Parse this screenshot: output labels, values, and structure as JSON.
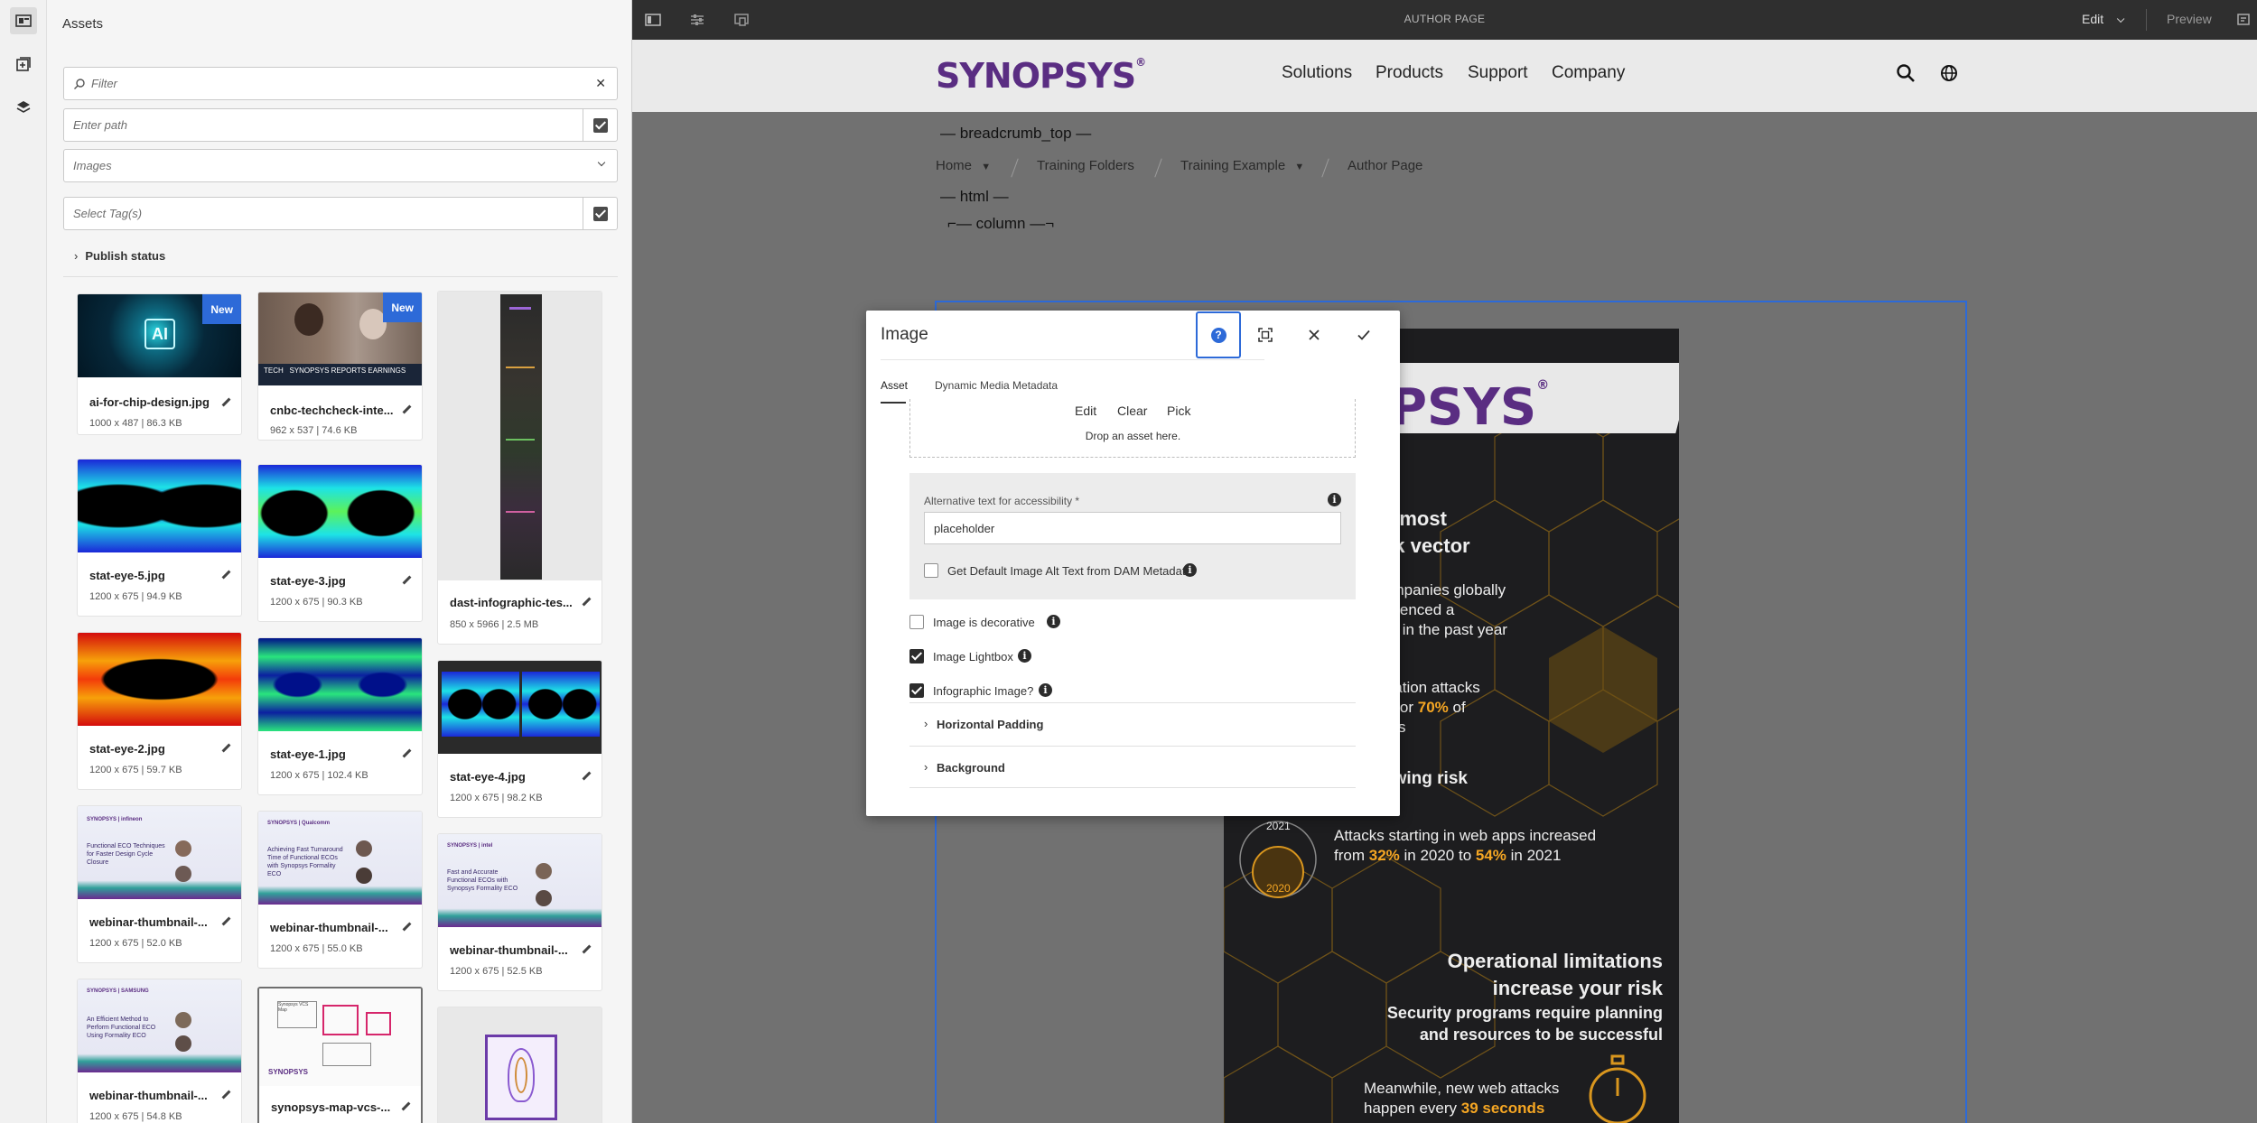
{
  "panel": {
    "title": "Assets",
    "filter_placeholder": "Filter",
    "path_placeholder": "Enter path",
    "type_selected": "Images",
    "tags_placeholder": "Select Tag(s)",
    "publish_status": "Publish status",
    "new_badge": "New"
  },
  "assets": [
    {
      "name": "ai-for-chip-design.jpg",
      "meta": "1000 x 487 | 86.3 KB",
      "new": true
    },
    {
      "name": "cnbc-techcheck-inte...",
      "meta": "962 x 537 | 74.6 KB",
      "new": true
    },
    {
      "name": "dast-infographic-tes...",
      "meta": "850 x 5966 | 2.5 MB"
    },
    {
      "name": "stat-eye-5.jpg",
      "meta": "1200 x 675 | 94.9 KB"
    },
    {
      "name": "stat-eye-3.jpg",
      "meta": "1200 x 675 | 90.3 KB"
    },
    {
      "name": "stat-eye-4.jpg",
      "meta": "1200 x 675 | 98.2 KB"
    },
    {
      "name": "stat-eye-2.jpg",
      "meta": "1200 x 675 | 59.7 KB"
    },
    {
      "name": "stat-eye-1.jpg",
      "meta": "1200 x 675 | 102.4 KB"
    },
    {
      "name": "webinar-thumbnail-...",
      "meta": "1200 x 675 | 52.0 KB"
    },
    {
      "name": "webinar-thumbnail-...",
      "meta": "1200 x 675 | 55.0 KB"
    },
    {
      "name": "webinar-thumbnail-...",
      "meta": "1200 x 675 | 52.5 KB"
    },
    {
      "name": "webinar-thumbnail-...",
      "meta": "1200 x 675 | 54.8 KB"
    },
    {
      "name": "synopsys-map-vcs-...",
      "meta": ""
    }
  ],
  "topbar": {
    "title": "AUTHOR PAGE",
    "mode": "Edit",
    "preview": "Preview"
  },
  "site": {
    "logo": "SYNOPSYS",
    "nav": [
      "Solutions",
      "Products",
      "Support",
      "Company"
    ]
  },
  "page": {
    "breadcrumb_component": "breadcrumb_top",
    "breadcrumb": [
      "Home",
      "Training Folders",
      "Training Example",
      "Author Page"
    ],
    "html_component": "html",
    "column_component": "column"
  },
  "infographic": {
    "logo": "PSYS",
    "line1": "e most",
    "line2": "ck vector",
    "line3": "ompanies globally",
    "line4": "erienced a",
    "line5": "ck in the past year",
    "line6": "ication attacks",
    "line7a": "d for ",
    "line7b": "70%",
    "line7c": " of",
    "line8": "cks",
    "line9": "owing risk",
    "year1": "2021",
    "year2": "2020",
    "stat_a": "Attacks starting in web apps increased",
    "stat_b1": "from ",
    "stat_b2": "32%",
    "stat_b3": " in 2020 to ",
    "stat_b4": "54%",
    "stat_b5": " in 2021",
    "op1": "Operational limitations",
    "op2": "increase your risk",
    "op3": "Security programs require planning",
    "op4": "and resources to be successful",
    "mean1": "Meanwhile, new web attacks",
    "mean2a": "happen every ",
    "mean2b": "39 seconds"
  },
  "dialog": {
    "title": "Image",
    "tabs": [
      "Asset",
      "Dynamic Media Metadata"
    ],
    "actions": [
      "Edit",
      "Clear",
      "Pick"
    ],
    "drop_hint": "Drop an asset here.",
    "alt_label": "Alternative text for accessibility *",
    "alt_value": "placeholder",
    "dam_alt": "Get Default Image Alt Text from DAM Metadata",
    "decorative": "Image is decorative",
    "lightbox": "Image Lightbox",
    "infographic": "Infographic Image?",
    "horizontal_padding": "Horizontal Padding",
    "background": "Background",
    "help_glyph": "?",
    "info_glyph": "i"
  },
  "colors": {
    "accent": "#2d6ad8",
    "brand": "#5a2d82",
    "highlight": "#f5a623"
  }
}
